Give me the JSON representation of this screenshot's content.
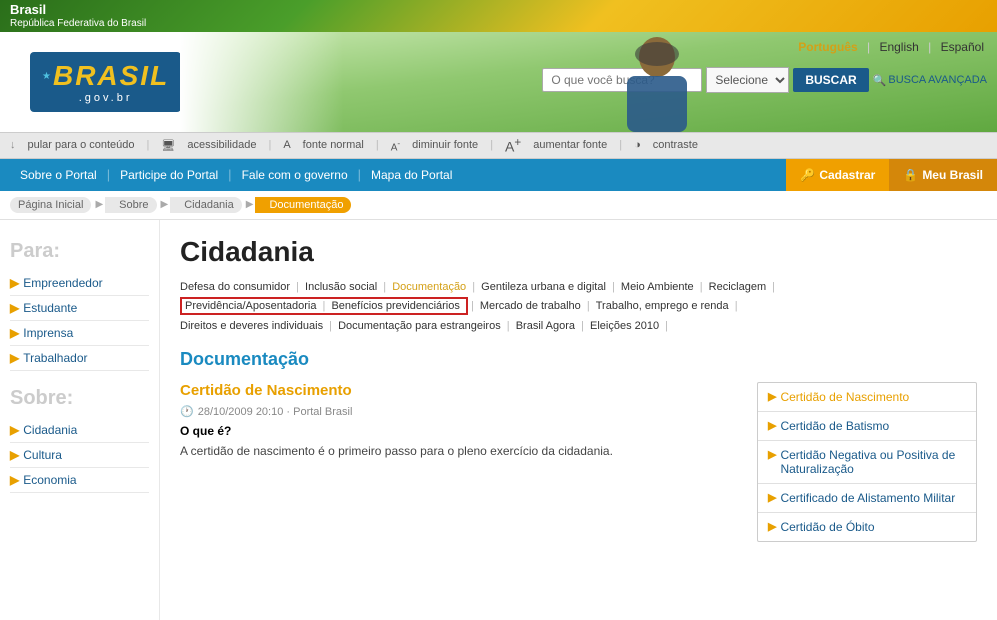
{
  "topBanner": {
    "title": "Brasil",
    "subtitle": "República Federativa do Brasil"
  },
  "languages": {
    "pt": "Português",
    "en": "English",
    "es": "Español",
    "active": "pt"
  },
  "logo": {
    "main": "BRASIL",
    "sub": ".gov.br"
  },
  "search": {
    "placeholder": "O que você busca?",
    "select_label": "Selecione",
    "button": "BUSCAR",
    "advanced": "BUSCA AVANÇADA"
  },
  "toolbar": {
    "skip": "pular para o conteúdo",
    "accessibility": "acessibilidade",
    "font_normal": "fonte normal",
    "font_decrease": "diminuir fonte",
    "font_increase": "aumentar fonte",
    "contrast": "contraste"
  },
  "navBar": {
    "links": [
      "Sobre o Portal",
      "Participe do Portal",
      "Fale com o governo",
      "Mapa do Portal"
    ],
    "cadastrar": "Cadastrar",
    "meubrasil": "Meu Brasil"
  },
  "breadcrumb": [
    {
      "label": "Página Inicial",
      "active": false
    },
    {
      "label": "Sobre",
      "active": false
    },
    {
      "label": "Cidadania",
      "active": false
    },
    {
      "label": "Documentação",
      "active": true
    }
  ],
  "sidebar": {
    "para_title": "Para:",
    "para_items": [
      "Empreendedor",
      "Estudante",
      "Imprensa",
      "Trabalhador"
    ],
    "sobre_title": "Sobre:",
    "sobre_items": [
      "Cidadania",
      "Cultura",
      "Economia"
    ]
  },
  "content": {
    "page_title": "Cidadania",
    "sub_nav_items": [
      {
        "label": "Defesa do consumidor",
        "active": false
      },
      {
        "label": "Inclusão social",
        "active": false
      },
      {
        "label": "Documentação",
        "active": true
      },
      {
        "label": "Gentileza urbana e digital",
        "active": false
      },
      {
        "label": "Meio Ambiente",
        "active": false
      },
      {
        "label": "Reciclagem",
        "active": false
      },
      {
        "label": "Previdência/Aposentadoria",
        "active": false,
        "highlight": true
      },
      {
        "label": "Benefícios previdenciários",
        "active": false,
        "highlight": true
      },
      {
        "label": "Mercado de trabalho",
        "active": false
      },
      {
        "label": "Trabalho, emprego e renda",
        "active": false
      },
      {
        "label": "Direitos e deveres individuais",
        "active": false
      },
      {
        "label": "Documentação para estrangeiros",
        "active": false
      },
      {
        "label": "Brasil Agora",
        "active": false
      },
      {
        "label": "Eleições 2010",
        "active": false
      }
    ],
    "section_title": "Documentação",
    "article": {
      "subtitle": "Certidão de Nascimento",
      "meta": "28/10/2009 20:10 · Portal Brasil",
      "bold_intro": "O que é?",
      "text": "A certidão de nascimento é o primeiro passo para o pleno exercício da cidadania."
    },
    "sidebar_list": [
      {
        "label": "Certidão de Nascimento",
        "active": true
      },
      {
        "label": "Certidão de Batismo",
        "active": false
      },
      {
        "label": "Certidão Negativa ou Positiva de Naturalização",
        "active": false
      },
      {
        "label": "Certificado de Alistamento Militar",
        "active": false
      },
      {
        "label": "Certidão de Óbito",
        "active": false
      }
    ]
  }
}
